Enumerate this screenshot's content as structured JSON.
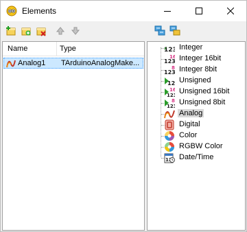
{
  "window": {
    "title": "Elements",
    "controls": {
      "minimize": "minimize",
      "maximize": "maximize",
      "close": "close"
    }
  },
  "toolbar_left": [
    "add-icon",
    "add-alt-icon",
    "delete-icon",
    "move-up-icon",
    "move-down-icon"
  ],
  "toolbar_right": [
    "expand-icon",
    "collapse-icon"
  ],
  "list": {
    "columns": [
      "Name",
      "Type"
    ],
    "rows": [
      {
        "name": "Analog1",
        "type": "TArduinoAnalogMake...",
        "icon": "analog-icon",
        "selected": true
      }
    ]
  },
  "palette": {
    "items": [
      {
        "label": "Integer",
        "icon": "integer-icon"
      },
      {
        "label": "Integer 16bit",
        "icon": "integer16-icon"
      },
      {
        "label": "Integer 8bit",
        "icon": "integer8-icon"
      },
      {
        "label": "Unsigned",
        "icon": "unsigned-icon"
      },
      {
        "label": "Unsigned 16bit",
        "icon": "unsigned16-icon"
      },
      {
        "label": "Unsigned 8bit",
        "icon": "unsigned8-icon"
      },
      {
        "label": "Analog",
        "icon": "analog-icon",
        "selected": true
      },
      {
        "label": "Digital",
        "icon": "digital-icon"
      },
      {
        "label": "Color",
        "icon": "color-icon"
      },
      {
        "label": "RGBW Color",
        "icon": "rgbw-color-icon"
      },
      {
        "label": "Date/Time",
        "icon": "datetime-icon"
      }
    ],
    "badges": [
      "16",
      "8",
      "16",
      "8"
    ],
    "digits": "123",
    "datetime_badge": "12"
  },
  "colors": {
    "selection": "#cce8ff",
    "selection_border": "#3399ff",
    "tree_selected": "#d9d9d9"
  }
}
